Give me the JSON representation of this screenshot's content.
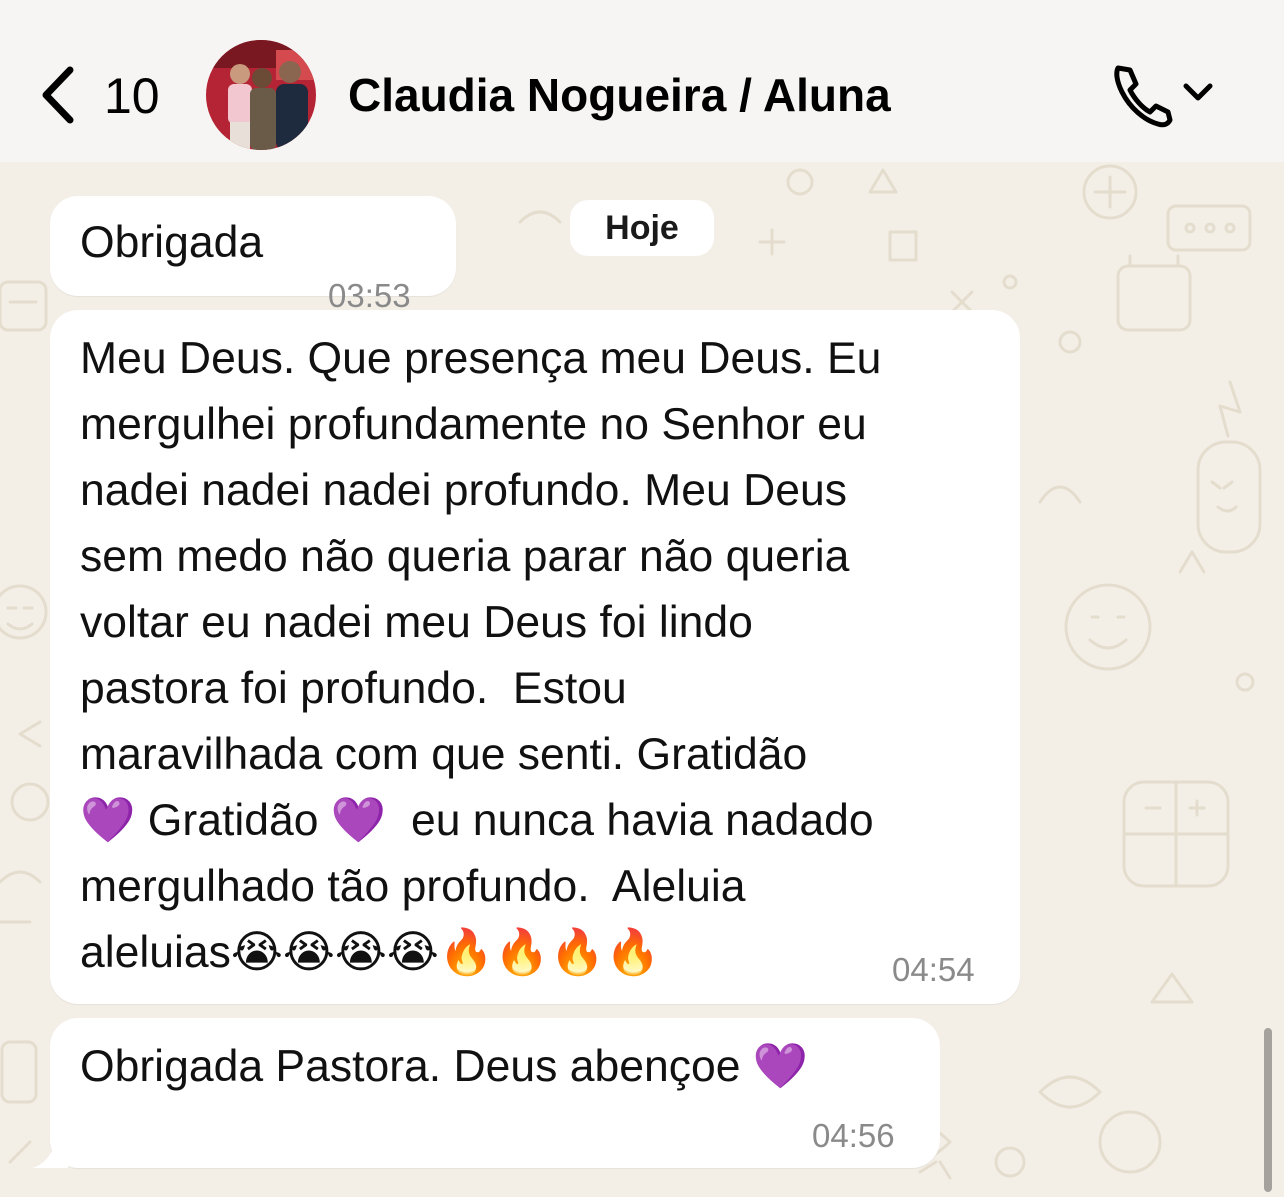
{
  "header": {
    "back_count": "10",
    "contact_name": "Claudia Nogueira / Aluna"
  },
  "date_chip": "Hoje",
  "messages": [
    {
      "text": "Obrigada",
      "time": "03:53"
    },
    {
      "lines": [
        "Meu Deus. Que presença meu Deus. Eu",
        "mergulhei profundamente no Senhor eu",
        "nadei nadei nadei profundo. Meu Deus",
        "sem medo não queria parar não queria",
        "voltar eu nadei meu Deus foi lindo",
        "pastora foi profundo.  Estou",
        "maravilhada com que senti. Gratidão",
        "💜 Gratidão 💜  eu nunca havia nadado",
        "mergulhado tão profundo.  Aleluia",
        "aleluias😭😭😭😭🔥🔥🔥🔥"
      ],
      "time": "04:54"
    },
    {
      "text": "Obrigada Pastora. Deus abençoe 💜",
      "time": "04:56"
    }
  ],
  "icons": {
    "back": "chevron-left-icon",
    "call": "phone-icon",
    "call_menu": "chevron-down-icon",
    "reaction_heart": "purple-heart-emoji"
  },
  "colors": {
    "header_bg": "#F6F5F3",
    "chat_bg": "#F3EFE7",
    "bubble": "#FFFFFF",
    "time_text": "#8A8A8A",
    "heart": "#9B3FE0"
  }
}
